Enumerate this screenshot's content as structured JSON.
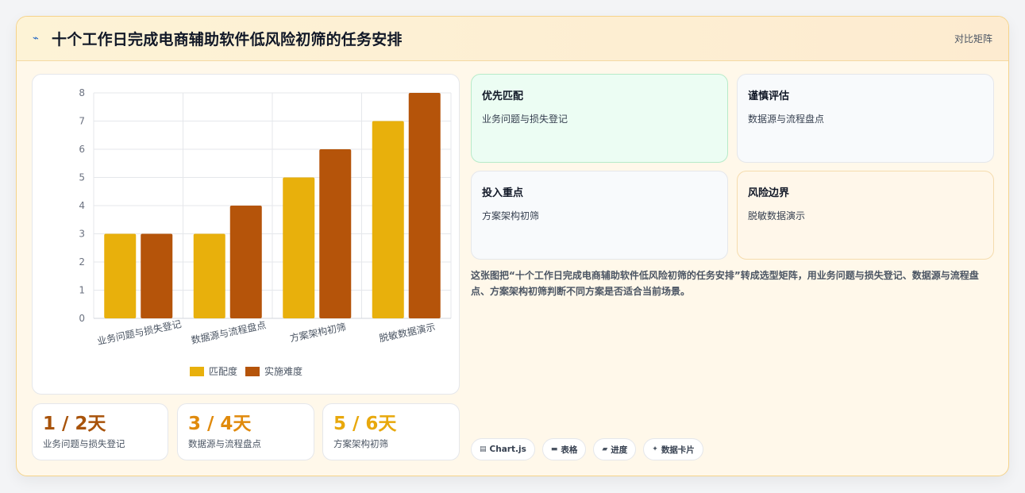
{
  "header": {
    "icon": "lightning-icon",
    "title": "十个工作日完成电商辅助软件低风险初筛的任务安排",
    "link": "对比矩阵"
  },
  "chart_data": {
    "type": "bar",
    "categories": [
      "业务问题与损失登记",
      "数据源与流程盘点",
      "方案架构初筛",
      "脱敏数据演示"
    ],
    "series": [
      {
        "name": "匹配度",
        "values": [
          3,
          3,
          5,
          7
        ],
        "color": "#e8b00c"
      },
      {
        "name": "实施难度",
        "values": [
          3,
          4,
          6,
          8
        ],
        "color": "#b5540a"
      }
    ],
    "ylim": [
      0,
      8
    ],
    "yticks": [
      0,
      1,
      2,
      3,
      4,
      5,
      6,
      7,
      8
    ],
    "grid": true,
    "legend": "bottom"
  },
  "stats": [
    {
      "value": "1 / 2天",
      "label": "业务问题与损失登记",
      "color": "#a8530a"
    },
    {
      "value": "3 / 4天",
      "label": "数据源与流程盘点",
      "color": "#e08a0c"
    },
    {
      "value": "5 / 6天",
      "label": "方案架构初筛",
      "color": "#e8a80c"
    }
  ],
  "matrix": [
    {
      "title": "优先匹配",
      "text": "业务问题与损失登记",
      "bg": "#ecfdf3",
      "border": "#b7ebc9"
    },
    {
      "title": "谨慎评估",
      "text": "数据源与流程盘点",
      "bg": "#f8fafc",
      "border": "#e5e7eb"
    },
    {
      "title": "投入重点",
      "text": "方案架构初筛",
      "bg": "#f8fafc",
      "border": "#e5e7eb"
    },
    {
      "title": "风险边界",
      "text": "脱敏数据演示",
      "bg": "#fff7ea",
      "border": "#f5dcae"
    }
  ],
  "description": "这张图把“十个工作日完成电商辅助软件低风险初筛的任务安排”转成选型矩阵，用业务问题与损失登记、数据源与流程盘点、方案架构初筛判断不同方案是否适合当前场景。",
  "tags": [
    {
      "icon": "chart-icon",
      "label": "Chart.js"
    },
    {
      "icon": "table-icon",
      "label": "表格"
    },
    {
      "icon": "progress-icon",
      "label": "进度"
    },
    {
      "icon": "sparkle-icon",
      "label": "数据卡片"
    }
  ]
}
